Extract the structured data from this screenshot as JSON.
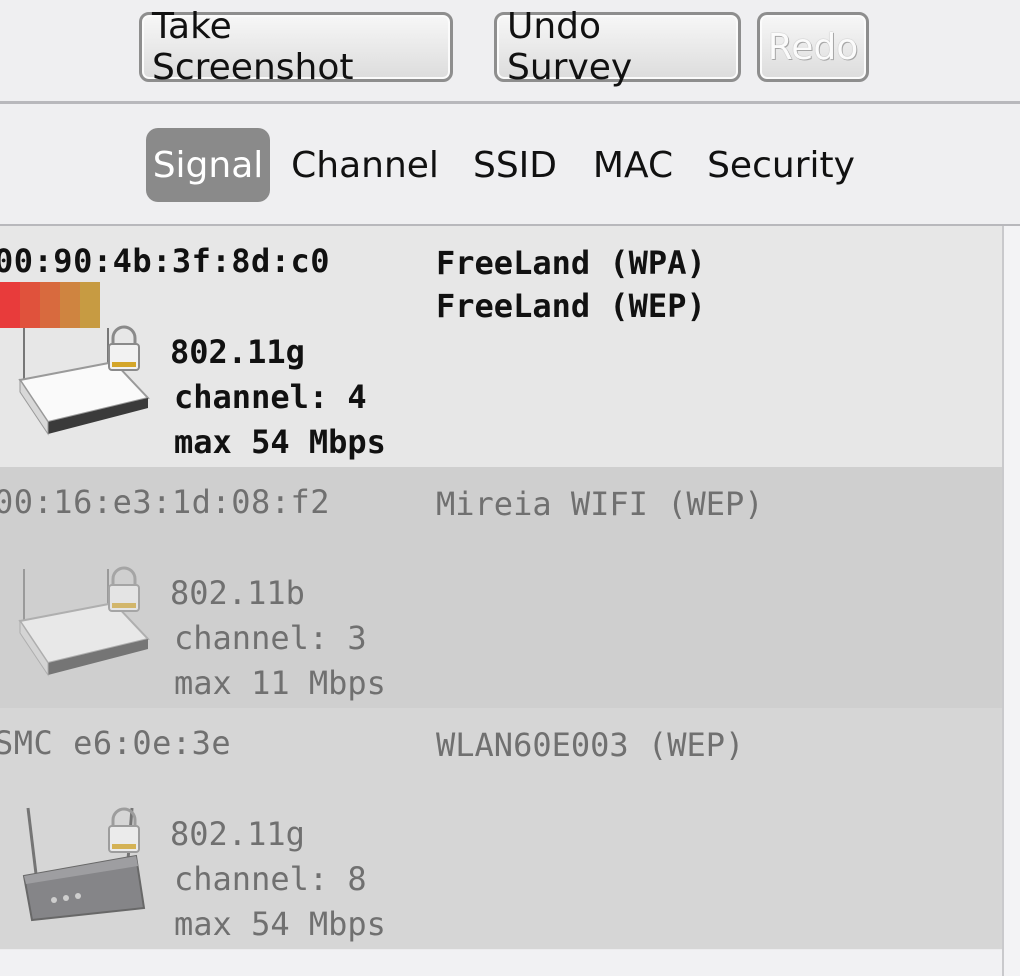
{
  "toolbar": {
    "take_screenshot": "Take Screenshot",
    "undo_survey": "Undo Survey",
    "redo": "Redo"
  },
  "sort_tabs": {
    "active": "Signal",
    "items": [
      {
        "label": "Signal"
      },
      {
        "label": "Channel"
      },
      {
        "label": "SSID"
      },
      {
        "label": "MAC"
      },
      {
        "label": "Security"
      }
    ]
  },
  "networks": [
    {
      "mac": "00:90:4b:3f:8d:c0",
      "ssids": [
        "FreeLand (WPA)",
        "FreeLand (WEP)"
      ],
      "standard": "802.11g",
      "channel": "channel: 4",
      "max_rate": "max 54 Mbps",
      "signal_colors": [
        "#e83b3b",
        "#e0523c",
        "#d86a3e",
        "#cf8440",
        "#c79b42"
      ],
      "router_icon": "router-white-icon",
      "lock_icon": "lock-icon"
    },
    {
      "mac": "00:16:e3:1d:08:f2",
      "ssids": [
        "Mireia WIFI (WEP)"
      ],
      "standard": "802.11b",
      "channel": "channel: 3",
      "max_rate": "max 11 Mbps",
      "router_icon": "router-white-icon",
      "lock_icon": "lock-icon"
    },
    {
      "mac": "SMC e6:0e:3e",
      "ssids": [
        "WLAN60E003 (WEP)"
      ],
      "standard": "802.11g",
      "channel": "channel: 8",
      "max_rate": "max 54 Mbps",
      "router_icon": "router-gray-icon",
      "lock_icon": "lock-icon"
    }
  ],
  "colors": {
    "active_tab": "#8a8a8a",
    "row_selected": "#e7e7e7",
    "row_dim": "#cfcfcf",
    "text_dim": "#707070"
  }
}
